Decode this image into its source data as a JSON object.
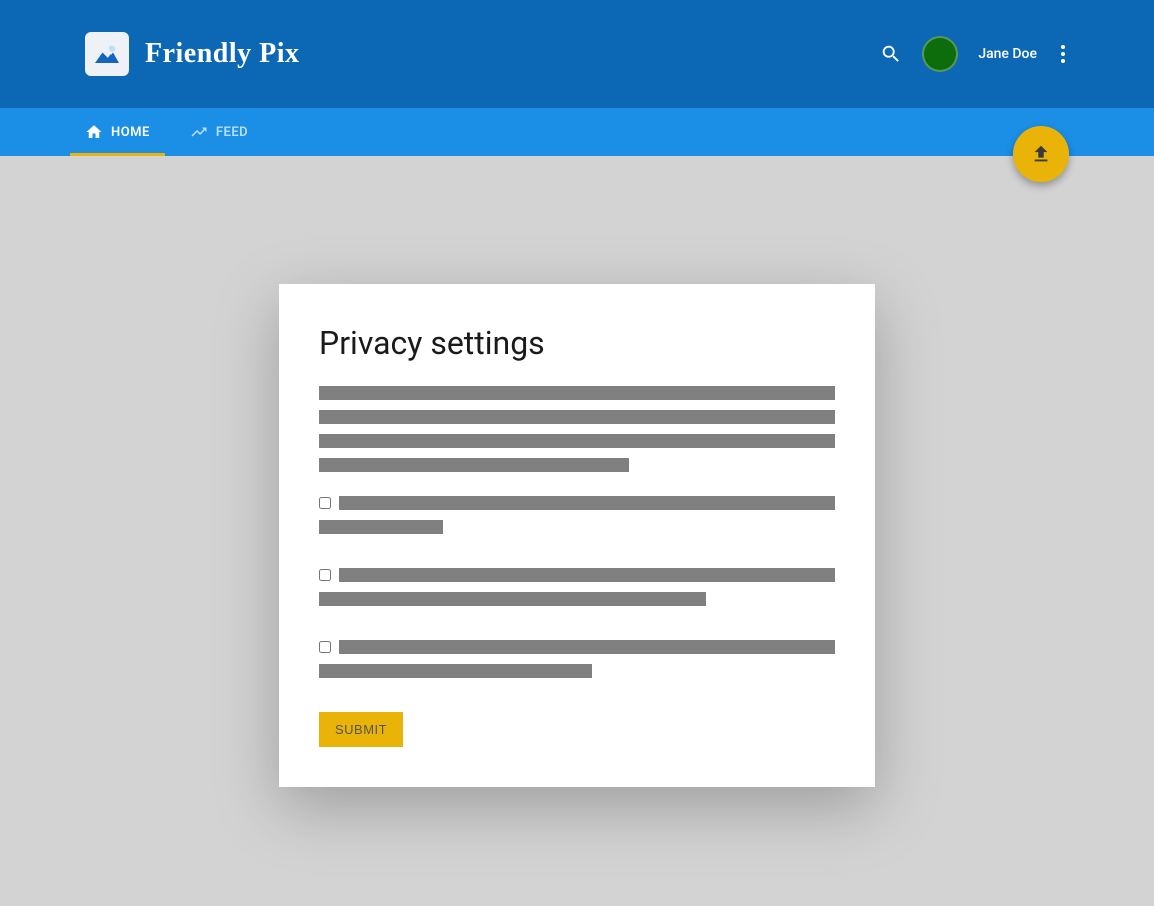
{
  "header": {
    "app_name": "Friendly Pix",
    "username": "Jane Doe"
  },
  "nav": {
    "tabs": [
      {
        "label": "HOME",
        "icon": "home",
        "active": true
      },
      {
        "label": "FEED",
        "icon": "trending",
        "active": false
      }
    ]
  },
  "card": {
    "title": "Privacy settings",
    "submit_label": "SUBMIT",
    "checkboxes": [
      {
        "checked": false
      },
      {
        "checked": false
      },
      {
        "checked": false
      }
    ]
  }
}
